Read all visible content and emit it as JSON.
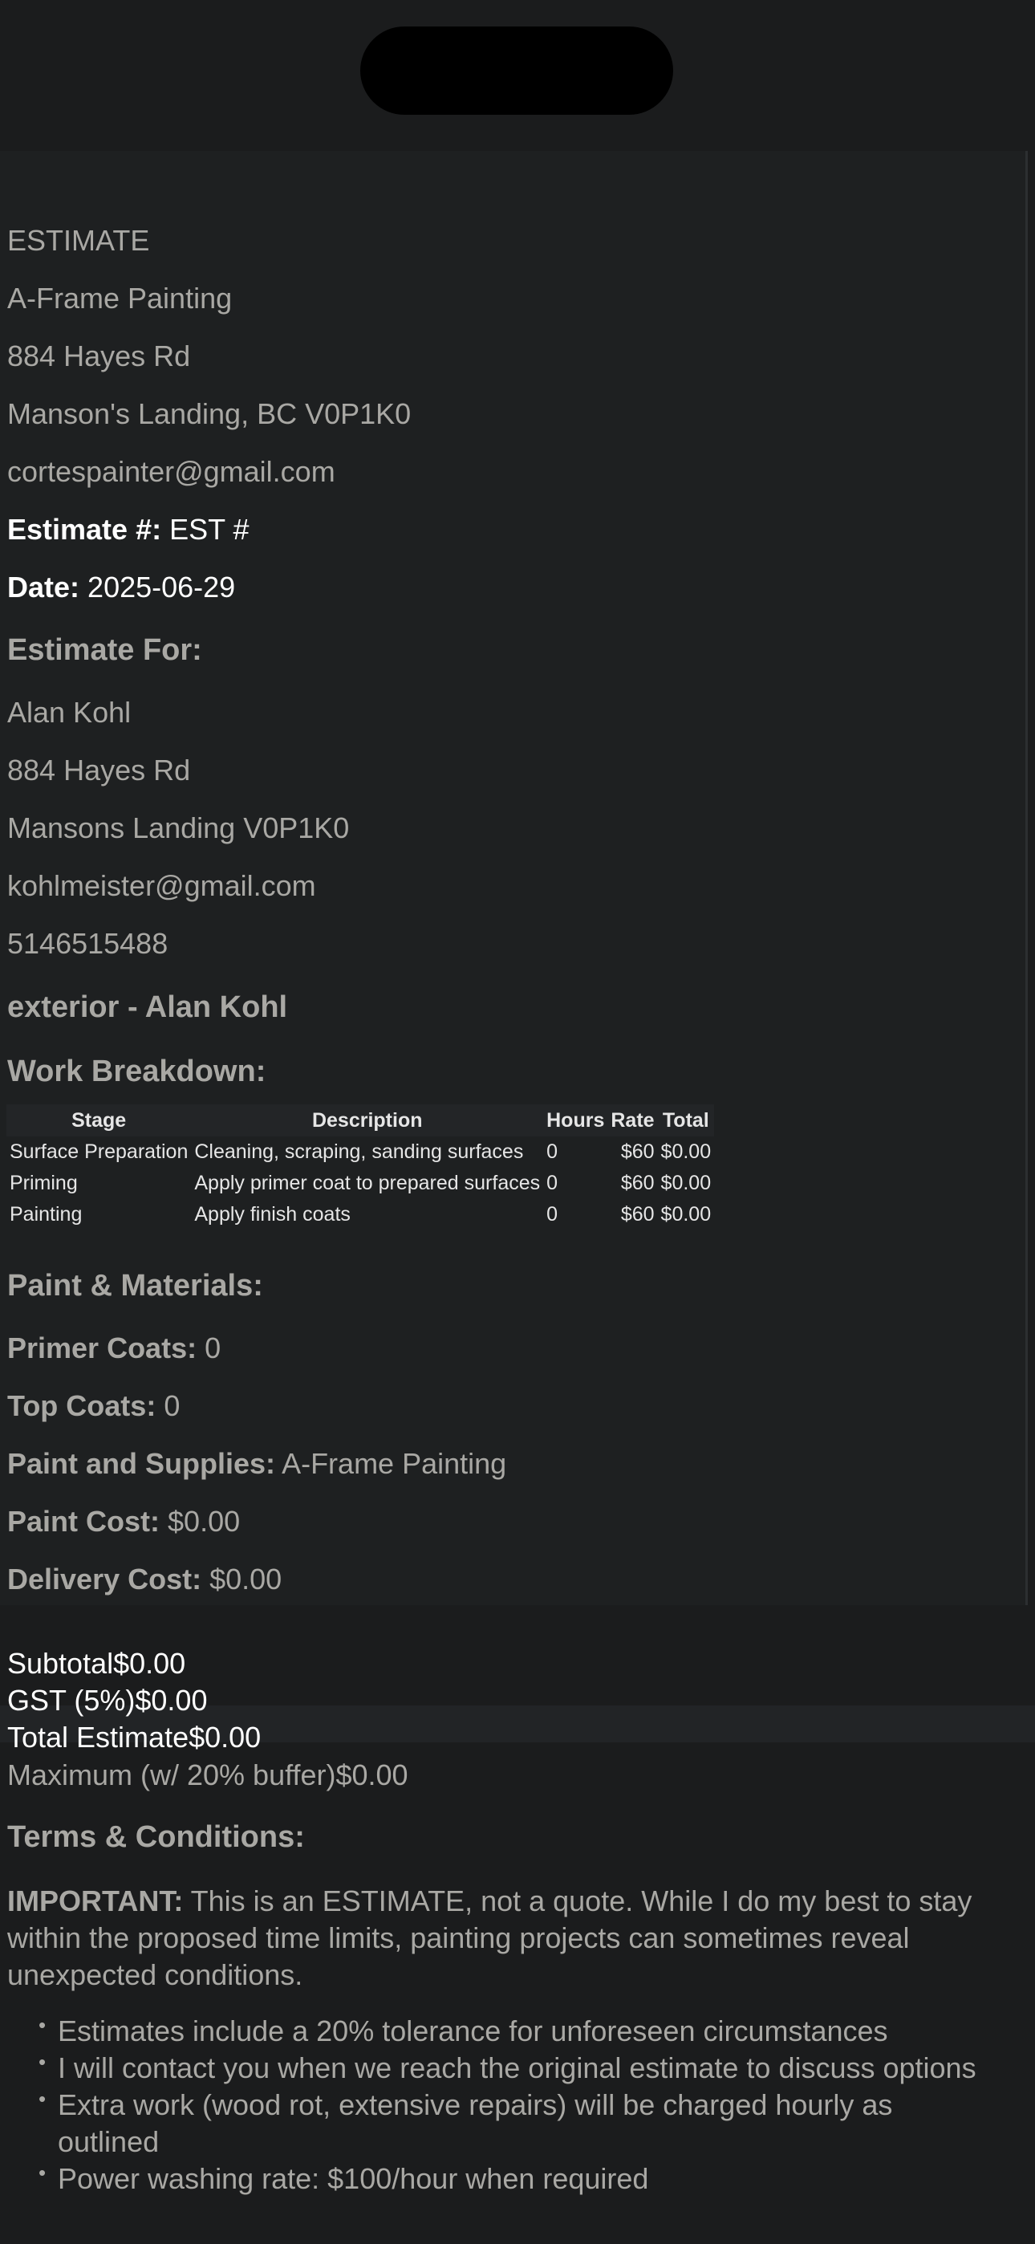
{
  "header": {
    "doc_type": "ESTIMATE",
    "company": "A-Frame Painting",
    "address1": "884 Hayes Rd",
    "address2": "Manson's Landing, BC V0P1K0",
    "email": "cortespainter@gmail.com"
  },
  "meta": {
    "estimate_label": "Estimate #:",
    "estimate_value": "EST #",
    "date_label": "Date:",
    "date_value": "2025-06-29"
  },
  "client": {
    "heading": "Estimate For:",
    "name": "Alan Kohl",
    "address1": "884 Hayes Rd",
    "address2": "Mansons Landing V0P1K0",
    "email": "kohlmeister@gmail.com",
    "phone": "5146515488"
  },
  "project_title": "exterior - Alan Kohl",
  "work": {
    "heading": "Work Breakdown:",
    "columns": [
      "Stage",
      "Description",
      "Hours",
      "Rate",
      "Total"
    ],
    "rows": [
      {
        "stage": "Surface Preparation",
        "description": "Cleaning, scraping, sanding surfaces",
        "hours": "0",
        "rate": "$60",
        "total": "$0.00"
      },
      {
        "stage": "Priming",
        "description": "Apply primer coat to prepared surfaces",
        "hours": "0",
        "rate": "$60",
        "total": "$0.00"
      },
      {
        "stage": "Painting",
        "description": "Apply finish coats",
        "hours": "0",
        "rate": "$60",
        "total": "$0.00"
      }
    ]
  },
  "materials": {
    "heading": "Paint & Materials:",
    "primer_label": "Primer Coats:",
    "primer_value": "0",
    "top_label": "Top Coats:",
    "top_value": "0",
    "supplies_label": "Paint and Supplies:",
    "supplies_value": "A-Frame Painting",
    "paint_cost_label": "Paint Cost:",
    "paint_cost_value": "$0.00",
    "delivery_label": "Delivery Cost:",
    "delivery_value": "$0.00"
  },
  "totals": {
    "subtotal_label": "Subtotal",
    "subtotal_value": "$0.00",
    "gst_label": "GST (5%)",
    "gst_value": "$0.00",
    "total_label": "Total Estimate",
    "total_value": "$0.00",
    "max_label": "Maximum (w/ 20% buffer)",
    "max_value": "$0.00"
  },
  "terms": {
    "heading": "Terms & Conditions:",
    "important_label": "IMPORTANT:",
    "important_text": " This is an ESTIMATE, not a quote. While I do my best to stay within the proposed time limits, painting projects can sometimes reveal unexpected conditions.",
    "bullets": [
      "Estimates include a 20% tolerance for unforeseen circumstances",
      "I will contact you when we reach the original estimate to discuss options",
      "Extra work (wood rot, extensive repairs) will be charged hourly as outlined",
      "Power washing rate: $100/hour when required"
    ]
  },
  "colors": {
    "background": "#1b1c1d",
    "text": "#a9a8a4",
    "white": "#ffffff"
  }
}
